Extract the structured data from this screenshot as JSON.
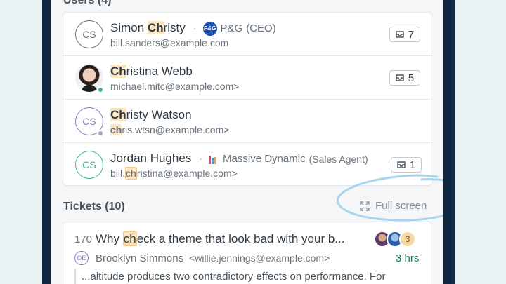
{
  "users_section": {
    "title": "Users (4)",
    "users": [
      {
        "initials": "CS",
        "name_prefix": "Simon ",
        "name_highlight": "Ch",
        "name_suffix": "risty",
        "org": "P&G",
        "org_role": "(CEO)",
        "org_logo_text": "P&G",
        "email_prefix": "",
        "email_highlight": "",
        "email_suffix": "bill.sanders@example.com",
        "tickets": "7"
      },
      {
        "initials": "",
        "name_prefix": "",
        "name_highlight": "Ch",
        "name_suffix": "ristina Webb",
        "email_prefix": "",
        "email_highlight": "",
        "email_suffix": "michael.mitc@example.com>",
        "tickets": "5"
      },
      {
        "initials": "CS",
        "name_prefix": "",
        "name_highlight": "Ch",
        "name_suffix": "risty Watson",
        "email_prefix": "",
        "email_highlight": "ch",
        "email_suffix": "ris.wtsn@example.com>",
        "tickets": ""
      },
      {
        "initials": "CS",
        "name_prefix": "Jordan Hughes",
        "name_highlight": "",
        "name_suffix": "",
        "org": "Massive Dynamic",
        "org_role": "(Sales Agent)",
        "email_prefix": "bill.",
        "email_highlight": "ch",
        "email_suffix": "ristina@example.com>",
        "tickets": "1"
      }
    ]
  },
  "tickets_section": {
    "title": "Tickets (10)",
    "fullscreen_label": "Full screen",
    "ticket": {
      "id": "170",
      "title_prefix": "Why ",
      "title_highlight": "ch",
      "title_suffix": "eck a theme that look bad with your b...",
      "agents_more": "3",
      "requester_initials": "DE",
      "requester_name": "Brooklyn Simmons",
      "requester_email": "<willie.jennings@example.com>",
      "time": "3 hrs",
      "snippet": "...altitude produces two contradictory effects on performance. For"
    }
  },
  "colors": {
    "background": "#e8f2f3",
    "panel": "#f5f6f7",
    "highlight": "#fbe5c2",
    "annotation": "#a9d3ee",
    "time_green": "#038153"
  }
}
